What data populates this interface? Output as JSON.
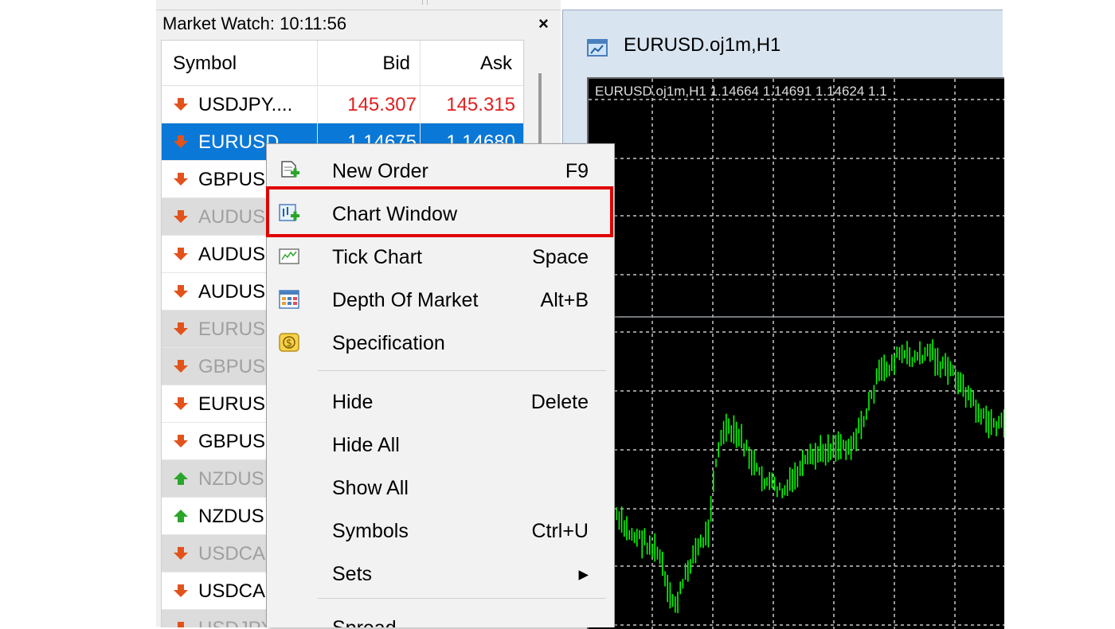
{
  "market_watch": {
    "title": "Market Watch: 10:11:56",
    "close_glyph": "×",
    "columns": {
      "symbol": "Symbol",
      "bid": "Bid",
      "ask": "Ask"
    },
    "rows": [
      {
        "symbol": "USDJPY....",
        "bid": "145.307",
        "ask": "145.315",
        "direction": "down",
        "state": "normal"
      },
      {
        "symbol": "EURUSD...",
        "bid": "1.14675",
        "ask": "1.14680",
        "direction": "down",
        "state": "selected"
      },
      {
        "symbol": "GBPUS",
        "bid": "",
        "ask": "",
        "direction": "down",
        "state": "normal"
      },
      {
        "symbol": "AUDUS",
        "bid": "",
        "ask": "",
        "direction": "down",
        "state": "disabled"
      },
      {
        "symbol": "AUDUS",
        "bid": "",
        "ask": "",
        "direction": "down",
        "state": "normal"
      },
      {
        "symbol": "AUDUS",
        "bid": "",
        "ask": "",
        "direction": "down",
        "state": "normal"
      },
      {
        "symbol": "EURUS",
        "bid": "",
        "ask": "",
        "direction": "down",
        "state": "disabled"
      },
      {
        "symbol": "GBPUS",
        "bid": "",
        "ask": "",
        "direction": "down",
        "state": "disabled"
      },
      {
        "symbol": "EURUS",
        "bid": "",
        "ask": "",
        "direction": "down",
        "state": "normal"
      },
      {
        "symbol": "GBPUS",
        "bid": "",
        "ask": "",
        "direction": "down",
        "state": "normal"
      },
      {
        "symbol": "NZDUS",
        "bid": "",
        "ask": "",
        "direction": "up",
        "state": "disabled"
      },
      {
        "symbol": "NZDUS",
        "bid": "",
        "ask": "",
        "direction": "up",
        "state": "normal"
      },
      {
        "symbol": "USDCA",
        "bid": "",
        "ask": "",
        "direction": "down",
        "state": "disabled"
      },
      {
        "symbol": "USDCA",
        "bid": "",
        "ask": "",
        "direction": "down",
        "state": "normal"
      },
      {
        "symbol": "USDJPY",
        "bid": "",
        "ask": "",
        "direction": "down",
        "state": "disabled"
      }
    ],
    "colors": {
      "price_down": "#e02020",
      "selected": "#0a78d7",
      "arrow_down": "#e2531c",
      "arrow_up": "#2aa52a"
    }
  },
  "context_menu": {
    "items": [
      {
        "label": "New Order",
        "shortcut": "F9",
        "icon": "new-order-icon"
      },
      {
        "label": "Chart Window",
        "shortcut": "",
        "icon": "chart-window-icon",
        "highlighted": true
      },
      {
        "label": "Tick Chart",
        "shortcut": "Space",
        "icon": "tick-chart-icon"
      },
      {
        "label": "Depth Of Market",
        "shortcut": "Alt+B",
        "icon": "depth-of-market-icon"
      },
      {
        "label": "Specification",
        "shortcut": "",
        "icon": "specification-icon"
      },
      {
        "label": "Hide",
        "shortcut": "Delete"
      },
      {
        "label": "Hide All",
        "shortcut": ""
      },
      {
        "label": "Show All",
        "shortcut": ""
      },
      {
        "label": "Symbols",
        "shortcut": "Ctrl+U"
      },
      {
        "label": "Sets",
        "shortcut": "▸"
      },
      {
        "label": "Spread",
        "shortcut": ""
      }
    ],
    "highlight_color": "#e00000"
  },
  "chart_window": {
    "title": "EURUSD.oj1m,H1",
    "info_line": "EURUSD.oj1m,H1  1.14664 1.14691 1.14624 1.1",
    "background": "#000000",
    "candle_color": "#00ff00",
    "grid_color": "#c8c8c8"
  }
}
